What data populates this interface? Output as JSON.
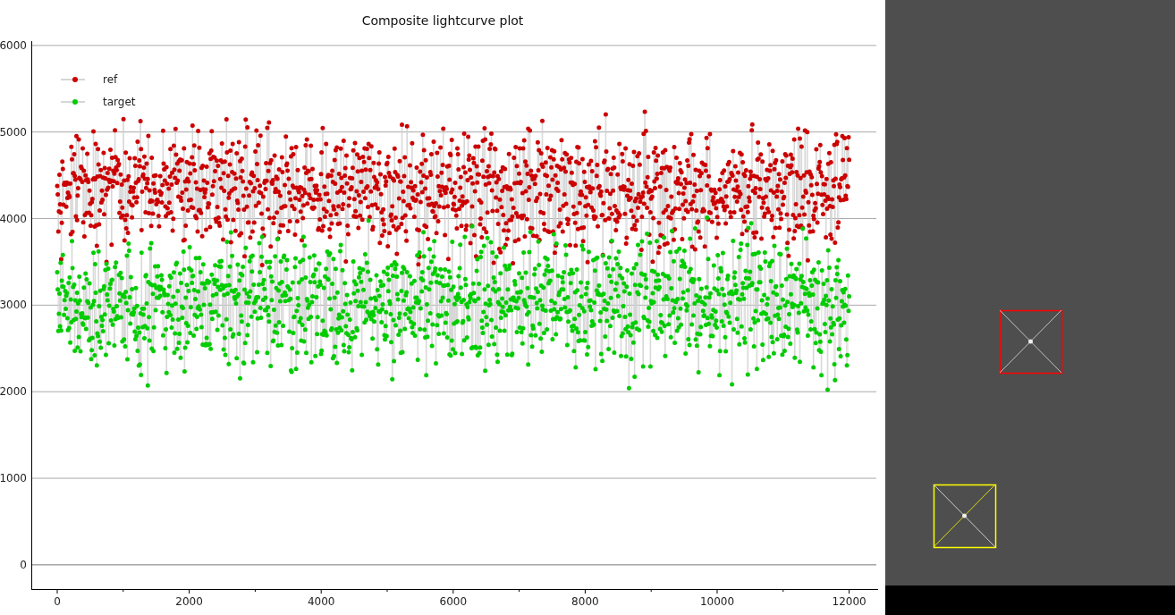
{
  "plot": {
    "title": "Composite lightcurve plot",
    "y_axis_labels": [
      "6000",
      "5000",
      "4000",
      "3000",
      "2000",
      "1000",
      "0"
    ],
    "x_axis_labels": [
      "0",
      "2000",
      "4000",
      "6000",
      "8000",
      "10000",
      "12000"
    ],
    "legend": [
      {
        "name": "ref",
        "color": "#cc0000"
      },
      {
        "name": "target",
        "color": "#00cc00"
      }
    ]
  },
  "image_view": {
    "markers": [
      {
        "kind": "reference",
        "color": "#ff0000"
      },
      {
        "kind": "target",
        "color": "#ffff00"
      }
    ]
  }
}
